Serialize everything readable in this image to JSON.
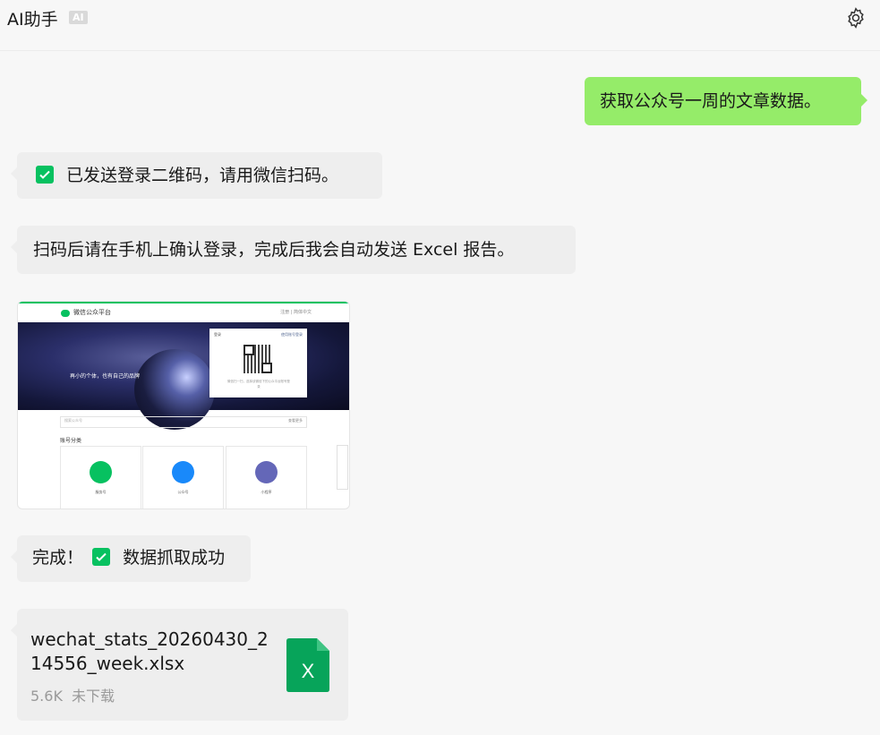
{
  "header": {
    "title": "AI助手",
    "badge": "AI",
    "settings_icon": "gear-icon"
  },
  "messages": {
    "user_request": "获取公众号一周的文章数据。",
    "qr_sent": "已发送登录二维码，请用微信扫码。",
    "scan_instruction": "扫码后请在手机上确认登录，完成后我会自动发送 Excel 报告。",
    "done_prefix": "完成！",
    "done_suffix": "数据抓取成功"
  },
  "screenshot": {
    "site_title": "微信公众平台",
    "nav_right": "注册 | 简体中文",
    "slogan": "再小的个体，也有自己的品牌",
    "login_title": "登录",
    "login_link": "使用账号登录",
    "qr_tip": "微信扫一扫，选择该微信下的公众平台账号登录",
    "search_placeholder": "搜索公众号",
    "search_more": "查看更多",
    "category_heading": "账号分类",
    "cards": [
      {
        "label": "服务号",
        "color": "#07c160"
      },
      {
        "label": "公众号",
        "color": "#1989fa"
      },
      {
        "label": "小程序",
        "color": "#6467b8"
      }
    ]
  },
  "file": {
    "name": "wechat_stats_20260430_214556_week.xlsx",
    "size": "5.6K",
    "status": "未下载",
    "icon_letter": "X",
    "icon_color": "#07a45a"
  },
  "colors": {
    "user_bubble": "#95ec69",
    "bot_bubble": "#eeeeee",
    "check_green": "#07c160"
  }
}
